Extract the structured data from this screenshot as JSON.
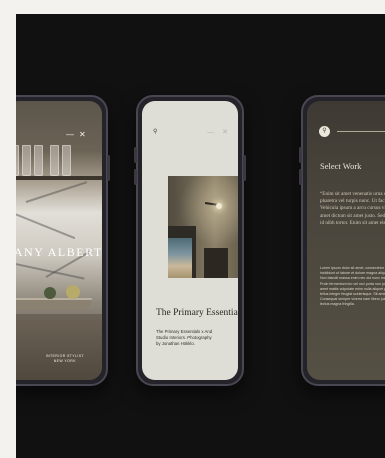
{
  "phones": {
    "left": {
      "brand": "TANY ALBERT",
      "footer": [
        "INTERIOR STYLIST",
        "NEW YORK"
      ],
      "minimize_glyph": "—",
      "close_glyph": "✕"
    },
    "middle": {
      "search_glyph": "⚲",
      "right_glyphs": "— ✕",
      "title": "The Primary Essentials",
      "caption": "The Primary Essentials x And\nStudio Interiors. Photography\nby Jonathan Hökklo."
    },
    "right": {
      "logo_glyph": "⚲",
      "title": "Select Work",
      "quote": "“Enim sit amet venenatis urna cursus eget. Bibendum at varius vel pharetra vel turpis nunc. Ut facilisis gravida neque convallis a cras. Vehicula ipsum a arcu cursus vitae congue mauris. Amet cursus sit amet dictum sit amet justo. Sed condimentum mattis pellentesque id nibh tortor. Enim sit amet elementum sagittis vitae et leo.”",
      "body": "Lorem ipsum dolor sit amet, consectetur adipiscing elit, sed do eiusmod tempor incididunt ut labore et dolore magna aliqua. Eu facilisi nunc mi ipsum faucibus vitae. Non blandit massa enim nec dui nunc mattis. Habitant morbi tristique senectus et netus. Proin fermentum leo vel orci porta non pulvinar. Nunc consequat interdum varius sit amet mattis vulputate enim nulla aliquet porttitor lacus luctus. Viverra adipiscing at in tellus integer feugiat scelerisque. Sit amet consectetur adipiscing elit duis tristique. Consequat semper viverra nam libero justo. Ut aliquam purus sit amet luctus venenatis lectus magna fringilla."
    }
  },
  "colors": {
    "page": "#f4f2ee",
    "backdrop": "#111111",
    "phone_frame": "#25232a",
    "middle_screen": "#deddd6",
    "right_screen": "#4a453c"
  }
}
